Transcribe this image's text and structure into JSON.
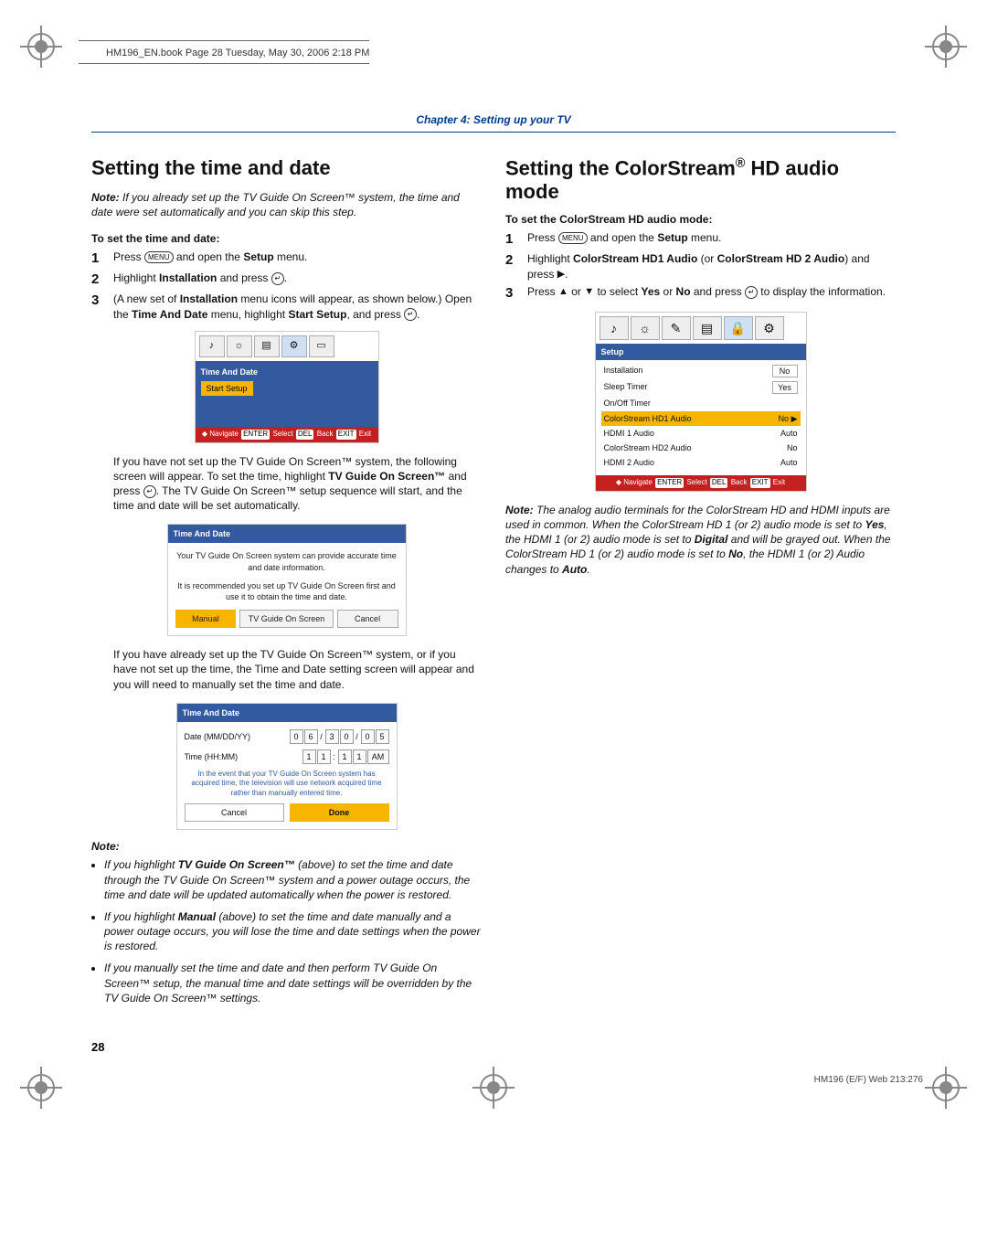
{
  "crop_header": "HM196_EN.book  Page 28  Tuesday, May 30, 2006  2:18 PM",
  "chapter": "Chapter 4: Setting up your TV",
  "left": {
    "h1": "Setting the time and date",
    "intro_note_label": "Note:",
    "intro_note_body": " If you already set up the TV Guide On Screen™ system, the time and date were set automatically and you can skip this step.",
    "subhead1": "To set the time and date:",
    "steps": {
      "s1": {
        "num": "1",
        "a": "Press ",
        "btn": "MENU",
        "b": " and open the ",
        "bold": "Setup",
        "c": " menu."
      },
      "s2": {
        "num": "2",
        "a": "Highlight ",
        "bold": "Installation",
        "b": " and press ",
        "btn": "ENTER",
        "c": "."
      },
      "s3": {
        "num": "3",
        "a": "(A new set of ",
        "bold1": "Installation",
        "b": " menu icons will appear, as shown below.) Open the ",
        "bold2": "Time And Date",
        "c": " menu, highlight ",
        "bold3": "Start Setup",
        "d": ", and press ",
        "btn": "ENTER",
        "e": "."
      }
    },
    "osd1": {
      "title": "Time And Date",
      "item": "Start Setup",
      "footer": {
        "nav": "Navigate",
        "sel": "Select",
        "back": "Back",
        "exit": "Exit",
        "k1": "ENTER",
        "k2": "DEL",
        "k3": "EXIT"
      }
    },
    "post1_a": "If you have not set up the TV Guide On Screen™ system, the following screen will appear. To set the time, highlight ",
    "post1_bold": "TV Guide On Screen™",
    "post1_b": " and press ",
    "post1_c": ". The TV Guide On Screen™ setup sequence will start, and the time and date will be set automatically.",
    "osd2": {
      "hdr": "Time And Date",
      "msg1": "Your TV Guide On Screen system can provide accurate time and date information.",
      "msg2": "It is recommended you set up TV Guide On Screen first and use it to obtain the time and date.",
      "btn1": "Manual",
      "btn2": "TV Guide On Screen",
      "btn3": "Cancel"
    },
    "post2": "If you have already set up the TV Guide On Screen™ system, or if you have not set up the time, the Time and Date setting screen will appear and you will need to manually set the time and date.",
    "osd2b": {
      "hdr": "Time And Date",
      "daterow": "Date (MM/DD/YY)",
      "datevals": [
        "0",
        "6",
        "/",
        "3",
        "0",
        "/",
        "0",
        "5"
      ],
      "timerow": "Time (HH:MM)",
      "timevals": [
        "1",
        "1",
        ":",
        "1",
        "1",
        "AM"
      ],
      "msg": "In the event that your TV Guide On Screen system has acquired time, the television will use network acquired time rather than manually entered time.",
      "btn1": "Cancel",
      "btn2": "Done"
    },
    "notes_label": "Note:",
    "bullets": [
      {
        "a": "If you highlight ",
        "b": "TV Guide On Screen™",
        "c": " (above) to set the time and date through the TV Guide On Screen™ system and a power outage occurs, the time and date will be updated automatically when the power is restored."
      },
      {
        "a": "If you highlight ",
        "b": "Manual",
        "c": " (above) to set the time and date manually and a power outage occurs, you will lose the time and date settings when the power is restored."
      },
      {
        "a": "If you manually set the time and date and then perform TV Guide On Screen™ setup, the manual time and date settings will be overridden by the TV Guide On Screen™ settings."
      }
    ]
  },
  "right": {
    "h1_a": "Setting the ColorStream",
    "h1_sup": "®",
    "h1_b": " HD audio mode",
    "subhead": "To set the ColorStream HD audio mode:",
    "steps": {
      "s1": {
        "num": "1",
        "a": "Press ",
        "btn": "MENU",
        "b": " and open the ",
        "bold": "Setup",
        "c": " menu."
      },
      "s2": {
        "num": "2",
        "a": "Highlight ",
        "bold1": "ColorStream HD1 Audio",
        "b": " (or ",
        "bold2": "ColorStream HD 2 Audio",
        "c": ") and press ",
        "tri": "▶",
        "d": "."
      },
      "s3": {
        "num": "3",
        "a": "Press ",
        "tri1": "▲",
        "b": " or ",
        "tri2": "▼",
        "c": " to select ",
        "bold1": "Yes",
        "d": " or ",
        "bold2": "No",
        "e": " and press ",
        "btn": "ENTER",
        "f": " to display the information."
      }
    },
    "osd3": {
      "setup": "Setup",
      "items": [
        {
          "label": "Installation",
          "val": "",
          "box": "No",
          "boxed": true
        },
        {
          "label": "Sleep Timer",
          "val": "",
          "box": "Yes",
          "boxed": true
        },
        {
          "label": "On/Off Timer",
          "val": ""
        },
        {
          "label": "ColorStream HD1 Audio",
          "val": "No ▶",
          "sel": true
        },
        {
          "label": "HDMI 1 Audio",
          "val": "Auto"
        },
        {
          "label": "ColorStream HD2 Audio",
          "val": "No"
        },
        {
          "label": "HDMI 2 Audio",
          "val": "Auto"
        }
      ],
      "footer": {
        "nav": "Navigate",
        "sel": "Select",
        "back": "Back",
        "exit": "Exit",
        "k1": "ENTER",
        "k2": "DEL",
        "k3": "EXIT"
      }
    },
    "note_label": "Note:",
    "note_body_a": " The analog audio terminals for the ColorStream HD and HDMI inputs are used in common. When the ColorStream HD 1 (or 2) audio mode is set to ",
    "note_bold1": "Yes",
    "note_body_b": ", the HDMI 1 (or 2) audio mode is set to ",
    "note_bold2": "Digital",
    "note_body_c": " and will be grayed out.  When the ColorStream HD 1 (or 2) audio mode is set to ",
    "note_bold3": "No",
    "note_body_d": ", the HDMI 1 (or 2) Audio changes to ",
    "note_bold4": "Auto",
    "note_body_e": "."
  },
  "page_num": "28",
  "footer_right": "HM196 (E/F) Web 213:276"
}
